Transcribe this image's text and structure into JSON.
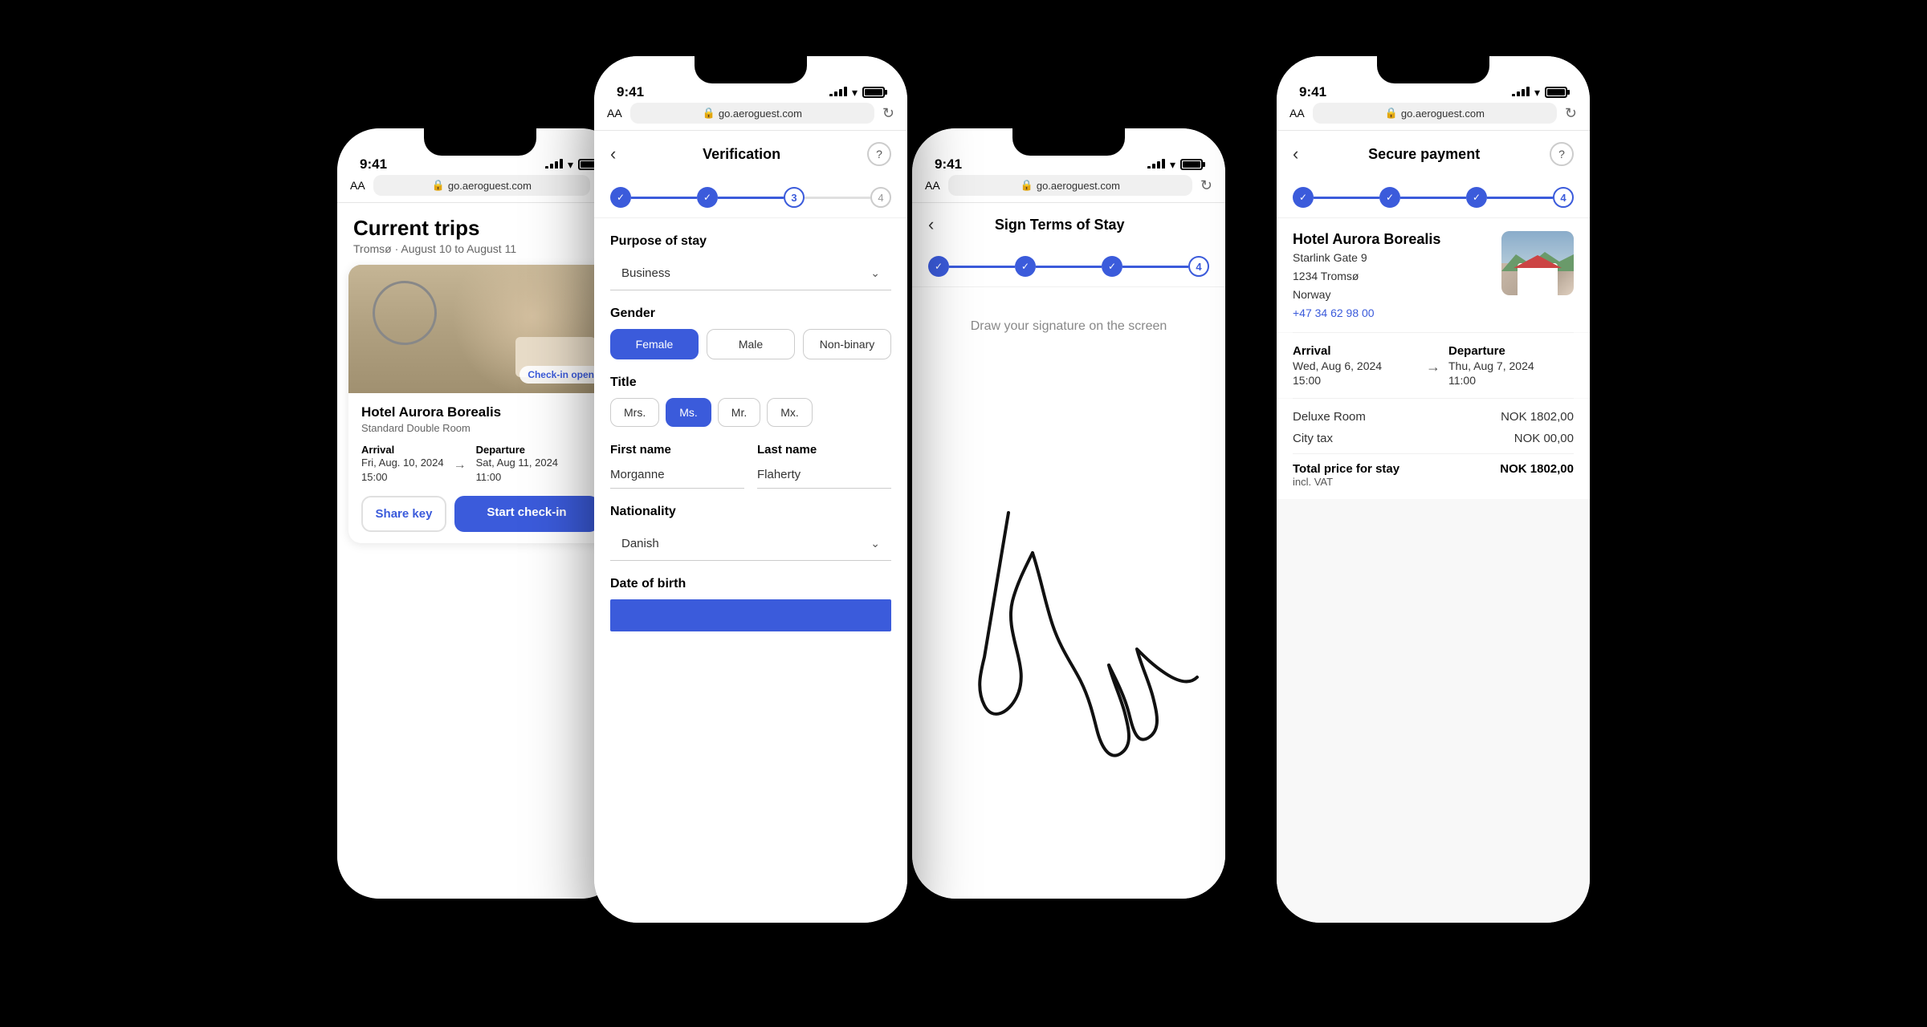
{
  "phone1": {
    "statusBar": {
      "time": "9:41",
      "url": "go.aeroguest.com"
    },
    "browserAA": "AA",
    "page": {
      "title": "Current trips",
      "subtitle": "Tromsø · August 10 to August 11"
    },
    "hotel": {
      "name": "Hotel Aurora Borealis",
      "room": "Standard Double Room",
      "arrivalLabel": "Arrival",
      "arrivalDate": "Fri, Aug. 10, 2024",
      "arrivalTime": "15:00",
      "departureLabel": "Departure",
      "departureDate": "Sat, Aug 11, 2024",
      "departureTime": "11:00",
      "checkInBadge": "Check-in open",
      "shareBtn": "Share key",
      "checkinBtn": "Start check-in"
    }
  },
  "phone2": {
    "statusBar": {
      "time": "9:41",
      "url": "go.aeroguest.com"
    },
    "browserAA": "AA",
    "page": {
      "title": "Verification",
      "step3": "3",
      "step4": "4"
    },
    "form": {
      "purposeLabel": "Purpose of stay",
      "purposeValue": "Business",
      "genderLabel": "Gender",
      "genderOptions": [
        "Female",
        "Male",
        "Non-binary"
      ],
      "genderActive": "Female",
      "titleLabel": "Title",
      "titleOptions": [
        "Mrs.",
        "Ms.",
        "Mr.",
        "Mx."
      ],
      "titleActive": "Ms.",
      "firstNameLabel": "First name",
      "firstNameValue": "Morganne",
      "lastNameLabel": "Last name",
      "lastNameValue": "Flaherty",
      "nationalityLabel": "Nationality",
      "nationalityValue": "Danish",
      "dobLabel": "Date of birth"
    }
  },
  "phone3": {
    "statusBar": {
      "time": "9:41",
      "url": "go.aeroguest.com"
    },
    "browserAA": "AA",
    "page": {
      "title": "Sign Terms of Stay",
      "step4": "4"
    },
    "prompt": "Draw your signature on the screen"
  },
  "phone4": {
    "statusBar": {
      "time": "9:41",
      "url": "go.aeroguest.com"
    },
    "browserAA": "AA",
    "page": {
      "title": "Secure payment",
      "step4": "4"
    },
    "hotel": {
      "name": "Hotel Aurora Borealis",
      "address1": "Starlink Gate 9",
      "address2": "1234 Tromsø",
      "address3": "Norway",
      "phone": "+47 34 62 98 00",
      "arrivalLabel": "Arrival",
      "arrivalDate": "Wed, Aug 6, 2024",
      "arrivalTime": "15:00",
      "departureLabel": "Departure",
      "departureDate": "Thu, Aug 7, 2024",
      "departureTime": "11:00"
    },
    "pricing": {
      "roomLabel": "Deluxe Room",
      "roomPrice": "NOK 1802,00",
      "taxLabel": "City tax",
      "taxPrice": "NOK 00,00",
      "totalLabel": "Total price for stay\nincl. VAT",
      "totalLabel1": "Total price for stay",
      "totalLabel2": "incl. VAT",
      "totalPrice": "NOK 1802,00"
    }
  },
  "icons": {
    "check": "✓",
    "back": "‹",
    "help": "?",
    "chevronDown": "⌄",
    "arrow": "→",
    "lock": "🔒",
    "refresh": "↻"
  }
}
